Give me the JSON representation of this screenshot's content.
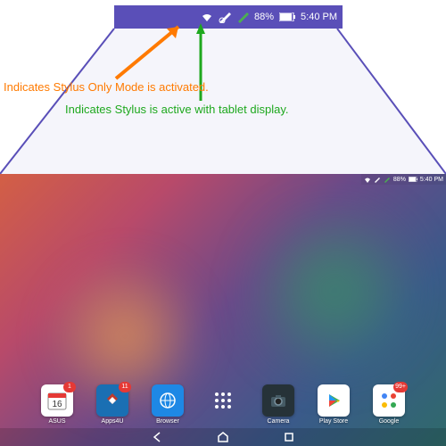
{
  "status_zoom": {
    "wifi_icon": "wifi",
    "stylus_only_icon": "stylus-only",
    "stylus_active_icon": "stylus-active",
    "battery_pct": "88%",
    "time": "5:40 PM"
  },
  "annotations": {
    "stylus_only": "Indicates Stylus Only Mode is activated.",
    "stylus_active": "Indicates Stylus is active with tablet display."
  },
  "tablet_status": {
    "battery_pct": "88%",
    "time": "5:40 PM"
  },
  "dock": [
    {
      "label": "ASUS",
      "color": "#fff",
      "badge": "1"
    },
    {
      "label": "Apps4U",
      "color": "#1a6fb3",
      "badge": "11"
    },
    {
      "label": "Browser",
      "color": "#1e88e5"
    },
    {
      "label": "",
      "color": "transparent"
    },
    {
      "label": "Camera",
      "color": "#263238"
    },
    {
      "label": "Play Store",
      "color": "#fff"
    },
    {
      "label": "Google",
      "color": "#fff",
      "badge": "99+"
    }
  ],
  "colors": {
    "annotation_orange": "#ff7a00",
    "annotation_green": "#1ea81e",
    "status_bg": "#5a4fb8"
  }
}
